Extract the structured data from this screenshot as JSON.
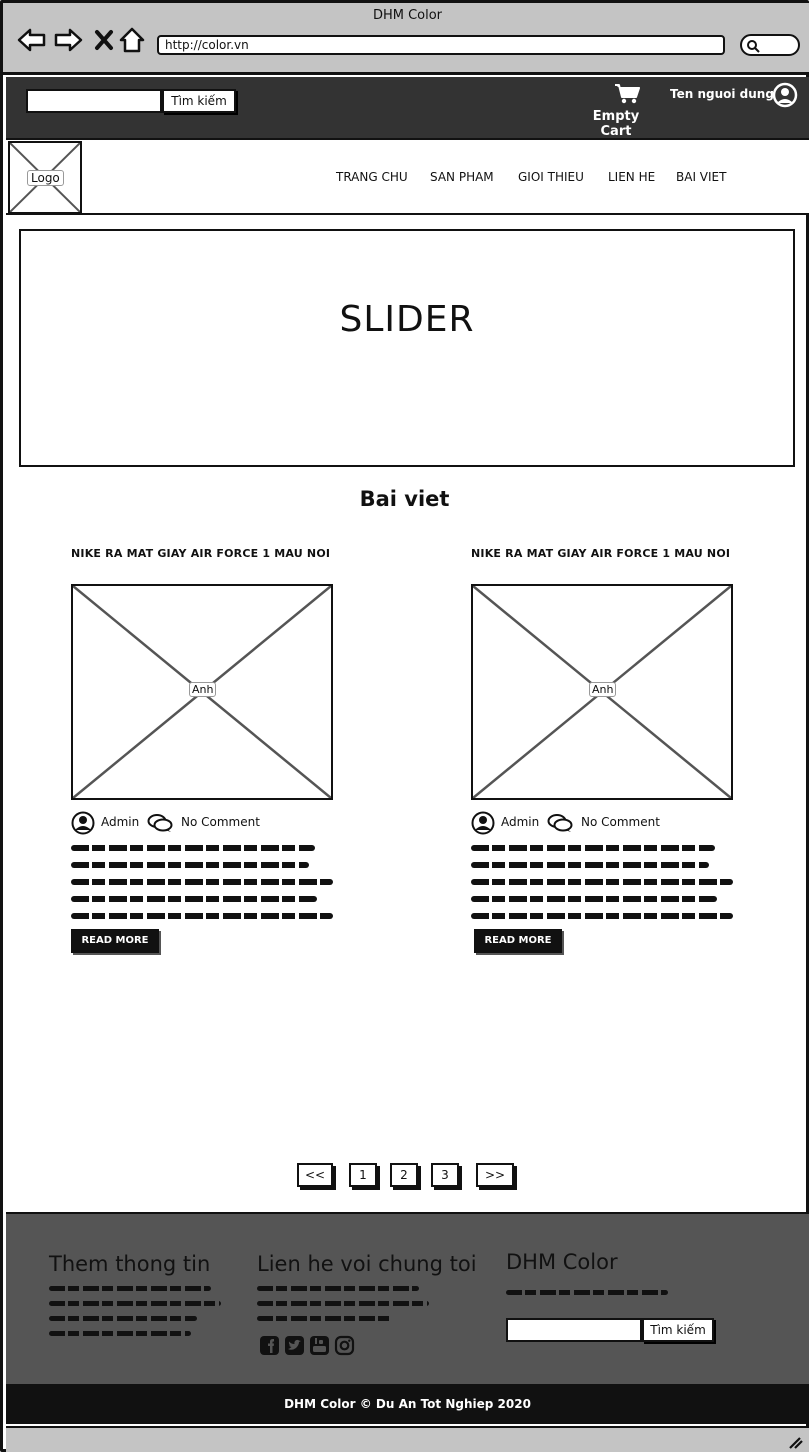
{
  "browser": {
    "title": "DHM Color",
    "url": "http://color.vn"
  },
  "topbar": {
    "search_button": "Tìm kiếm",
    "cart_label": "Empty Cart",
    "user_name": "Ten nguoi dung"
  },
  "header": {
    "logo": "Logo",
    "nav": [
      "TRANG CHU",
      "SAN PHAM",
      "GIOI THIEU",
      "LIEN HE",
      "BAI VIET"
    ]
  },
  "slider": {
    "label": "SLIDER"
  },
  "posts_section": {
    "title": "Bai viet",
    "posts": [
      {
        "title": "NIKE RA MAT GIAY AIR FORCE 1 MAU NOI",
        "image_label": "Anh",
        "author": "Admin",
        "comments": "No Comment",
        "read_more": "READ MORE"
      },
      {
        "title": "NIKE RA MAT GIAY AIR FORCE 1 MAU NOI",
        "image_label": "Anh",
        "author": "Admin",
        "comments": "No Comment",
        "read_more": "READ MORE"
      }
    ]
  },
  "pagination": [
    "<<",
    "1",
    "2",
    "3",
    ">>"
  ],
  "footer": {
    "col1_heading": "Them thong tin",
    "col2_heading": "Lien he voi chung toi",
    "col3_heading": "DHM Color",
    "search_button": "Tìm kiếm",
    "social_icons": [
      "facebook-icon",
      "twitter-icon",
      "youtube-icon",
      "instagram-icon"
    ],
    "copyright": "DHM Color © Du An Tot Nghiep 2020"
  }
}
